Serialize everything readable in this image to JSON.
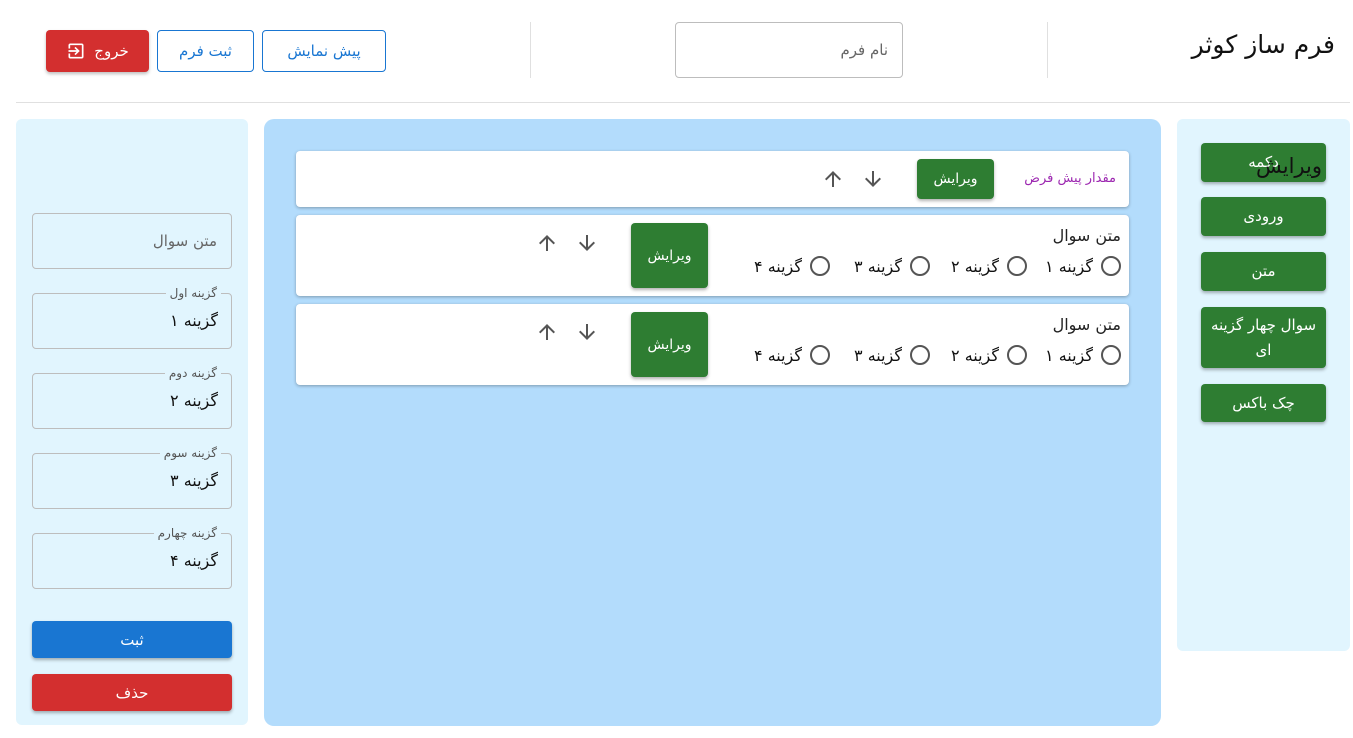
{
  "header": {
    "title": "فرم ساز کوثر",
    "form_name_placeholder": "نام فرم",
    "preview_label": "پیش نمایش",
    "submit_form_label": "ثبت فرم",
    "exit_label": "خروج"
  },
  "palette": {
    "items": [
      {
        "label": "دکمه"
      },
      {
        "label": "ورودی"
      },
      {
        "label": "متن"
      },
      {
        "label": "سوال چهار گزینه ای"
      },
      {
        "label": "چک باکس"
      }
    ]
  },
  "canvas": {
    "text_item": {
      "label": "مقدار پیش فرض",
      "edit_label": "ویرایش"
    },
    "questions": [
      {
        "text": "متن سوال",
        "options": [
          "گزینه ۱",
          "گزینه ۲",
          "گزینه ۳",
          "گزینه ۴"
        ],
        "edit_label": "ویرایش"
      },
      {
        "text": "متن سوال",
        "options": [
          "گزینه ۱",
          "گزینه ۲",
          "گزینه ۳",
          "گزینه ۴"
        ],
        "edit_label": "ویرایش"
      }
    ]
  },
  "edit_panel": {
    "title": "ویرایش",
    "question_placeholder": "متن سوال",
    "fields": [
      {
        "label": "گزینه اول",
        "value": "گزینه ۱"
      },
      {
        "label": "گزینه دوم",
        "value": "گزینه ۲"
      },
      {
        "label": "گزینه سوم",
        "value": "گزینه ۳"
      },
      {
        "label": "گزینه چهارم",
        "value": "گزینه ۴"
      }
    ],
    "save_label": "ثبت",
    "delete_label": "حذف"
  },
  "colors": {
    "green": "#2e7d32",
    "blue": "#1976d2",
    "red": "#d32f2f",
    "canvas_bg": "#b3dcfc",
    "panel_bg": "#e1f5fe",
    "default_value_purple": "#9c27b0"
  },
  "icons": {
    "exit": "logout-icon",
    "up": "arrow-up-icon",
    "down": "arrow-down-icon"
  }
}
